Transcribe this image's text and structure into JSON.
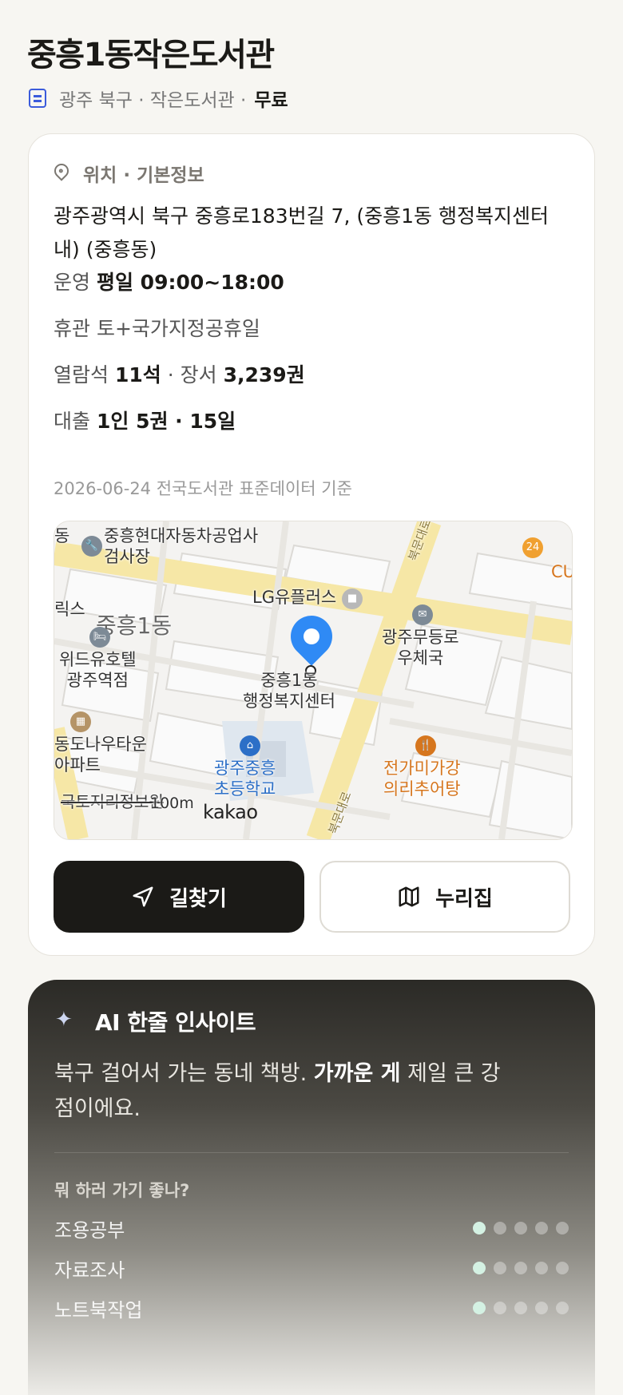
{
  "library": {
    "name": "중흥1동작은도서관",
    "meta": "광주 북구 · 작은도서관 ·",
    "fee": "무료"
  },
  "info": {
    "section_title": "위치 · 기본정보",
    "address": "광주광역시 북구 중흥로183번길 7, (중흥1동 행정복지센터 내) (중흥동)",
    "hours_label": "운영",
    "hours_value": "평일 09:00~18:00",
    "closed_label": "휴관",
    "closed_value": "토+국가지정공휴일",
    "seats_label": "열람석",
    "seats_value": "11석",
    "books_label": "· 장서",
    "books_value": "3,239권",
    "loan_label": "대출",
    "loan_value": "1인 5권 · 15일",
    "basis": "2026-06-24 전국도서관 표준데이터 기준"
  },
  "map": {
    "labels": {
      "garage": "중흥현대자동차공업사\n검사장",
      "lgplus": "LG유플러스",
      "dong": "중흥1동",
      "hotel": "위드유호텔\n광주역점",
      "center": "중흥1동\n행정복지센터",
      "post": "광주무등로\n우체국",
      "apt": "동도나우타운\n아파트",
      "school": "광주중흥\n초등학교",
      "restaurant": "전가미가강\n의리추어탕",
      "cu": "CU",
      "edge_left": "릭스",
      "edge_top": "동",
      "road": "북문대로",
      "road2": "북문대로",
      "ngii": "국토지리정보원",
      "scale": "100m",
      "brand": "kakao"
    }
  },
  "buttons": {
    "directions": "길찾기",
    "nurijip": "누리집"
  },
  "ai": {
    "title": "AI 한줄 인사이트",
    "text_before": "북구 걸어서 가는 동네 책방. ",
    "text_bold": "가까운 게",
    "text_after": " 제일 큰 강점이에요.",
    "question": "뭐 하러 가기 좋나?",
    "activities": [
      {
        "label": "조용공부",
        "score": 1
      },
      {
        "label": "자료조사",
        "score": 1
      },
      {
        "label": "노트북작업",
        "score": 1
      }
    ]
  },
  "colors": {
    "accent_blue": "#2f8af5",
    "dark": "#1b1a17",
    "score_on": "#d4f1e3"
  }
}
